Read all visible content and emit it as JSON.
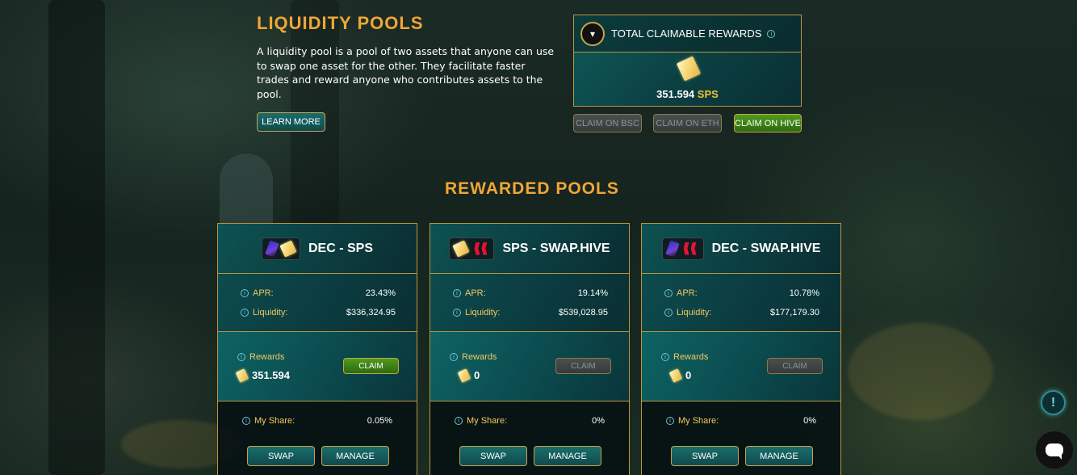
{
  "header": {
    "title": "LIQUIDITY POOLS",
    "description": "A liquidity pool is a pool of two assets that anyone can use to swap one asset for the other. They facilitate faster trades and reward anyone who contributes assets to the pool.",
    "learn_more_label": "LEARN MORE"
  },
  "total_rewards": {
    "label": "TOTAL CLAIMABLE REWARDS",
    "amount": "351.594",
    "currency": "SPS",
    "claim_bsc_label": "CLAIM ON BSC",
    "claim_eth_label": "CLAIM ON ETH",
    "claim_hive_label": "CLAIM ON HIVE"
  },
  "rewarded_pools_title": "REWARDED POOLS",
  "labels": {
    "apr": "APR:",
    "liquidity": "Liquidity:",
    "rewards": "Rewards",
    "claim": "CLAIM",
    "my_share": "My Share:",
    "swap": "SWAP",
    "manage": "MANAGE"
  },
  "pools": [
    {
      "name": "DEC - SPS",
      "apr": "23.43%",
      "liquidity": "$336,324.95",
      "rewards": "351.594",
      "claim_enabled": true,
      "my_share": "0.05%",
      "icons": [
        "dec-icon",
        "sps-icon"
      ]
    },
    {
      "name": "SPS - SWAP.HIVE",
      "apr": "19.14%",
      "liquidity": "$539,028.95",
      "rewards": "0",
      "claim_enabled": false,
      "my_share": "0%",
      "icons": [
        "sps-icon",
        "hive-icon"
      ]
    },
    {
      "name": "DEC - SWAP.HIVE",
      "apr": "10.78%",
      "liquidity": "$177,179.30",
      "rewards": "0",
      "claim_enabled": false,
      "my_share": "0%",
      "icons": [
        "dec-icon",
        "hive-icon"
      ]
    }
  ],
  "colors": {
    "accent": "#f0a636",
    "border_gold": "#b9963f",
    "claim_green": "#4f9a1f",
    "teal": "#0f5b5a"
  }
}
